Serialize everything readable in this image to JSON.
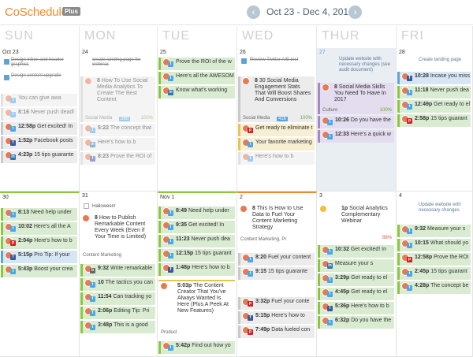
{
  "app": {
    "logo": "CoSchedule",
    "badge": "Plus",
    "range": "Oct 23 - Dec 4, 2016",
    "prev_icon": "chevron-left-icon",
    "next_icon": "chevron-right-icon"
  },
  "days": [
    "SUN",
    "MON",
    "TUE",
    "WED",
    "THUR",
    "FRI"
  ],
  "week1": {
    "sun": {
      "num": "Oct 23",
      "todos": [
        "Design inbox and header graphics",
        "Design content upgrade"
      ],
      "cards": [
        {
          "t": "",
          "txt": "You can give awa"
        },
        {
          "t": "8:16",
          "txt": "Never push deadl"
        },
        {
          "t": "12:58p",
          "txt": "Get excited! In"
        },
        {
          "t": "1:52p",
          "txt": "Facebook posts"
        },
        {
          "t": "4:23p",
          "txt": "15 tips guarante"
        }
      ]
    },
    "mon": {
      "num": "24",
      "todo": "create landing page for webinar",
      "big": {
        "num": "8",
        "title": "How To Use Social Media Analytics To Create The Best Content",
        "cat": "Social Media",
        "views": "260",
        "pct": "100%"
      },
      "cards": [
        {
          "t": "5:22",
          "txt": "The concept that"
        },
        {
          "t": "",
          "txt": "Here's how to b"
        },
        {
          "t": "8:23",
          "txt": "Prove the ROI of"
        }
      ]
    },
    "tue": {
      "num": "25",
      "cards": [
        {
          "t": "",
          "txt": "Prove the ROI of the w"
        },
        {
          "t": "",
          "txt": "Here's all the AWESOM"
        },
        {
          "t": "",
          "txt": "Know what's working"
        }
      ]
    },
    "wed": {
      "num": "26",
      "todo": "Review Twitter A/B test",
      "big": {
        "num": "8",
        "title": "30 Social Media Engagement Stats That Will Boost Shares And Conversions",
        "cat": "Social Media",
        "views": "416",
        "pct": "100%"
      },
      "cards": [
        {
          "t": "",
          "txt": "Get ready to eliminate t"
        },
        {
          "t": "",
          "txt": "Your favorite marketing"
        },
        {
          "t": "",
          "txt": "Here's how to b"
        }
      ]
    },
    "thu": {
      "num": "27",
      "todo": "Update website with necessary changes (see audit document)",
      "big": {
        "num": "8",
        "title": "Social Media Skills You Need To Have In 2017",
        "cat": "Culture",
        "pct": "100%"
      },
      "cards": [
        {
          "t": "10:26",
          "txt": "Do you have the"
        },
        {
          "t": "12:33",
          "txt": "Here's a quick w"
        }
      ]
    },
    "fri": {
      "num": "28",
      "todo": "Create landing page",
      "cards": [
        {
          "t": "10:28",
          "txt": "Incase you miss"
        },
        {
          "t": "11:18",
          "txt": "Never push dea"
        },
        {
          "t": "12:49p",
          "txt": "Get ready to el"
        },
        {
          "t": "2:58p",
          "txt": "15 tips guarant"
        }
      ]
    }
  },
  "week2": {
    "sun": {
      "num": "30",
      "cards": [
        {
          "t": "8:13",
          "txt": "Need help under"
        },
        {
          "t": "10:02",
          "txt": "Here's all the A"
        },
        {
          "t": "2:04p",
          "txt": "Here's how to b"
        },
        {
          "t": "5:15p",
          "txt": "Pro Tip: If your"
        },
        {
          "t": "5:43p",
          "txt": "Boost your crea"
        }
      ]
    },
    "mon": {
      "num": "31",
      "todo": "Halloween!",
      "big": {
        "num": "8",
        "title": "How to Publish Remarkable Content Every Week (Even if Your Time is Limited)",
        "cat": "Content Marketing",
        "pct": "100%"
      },
      "cards": [
        {
          "t": "9:32",
          "txt": "Write remarkable"
        },
        {
          "t": "10",
          "txt": "The tactics you can"
        },
        {
          "t": "11:54",
          "txt": "Can tracking yo"
        },
        {
          "t": "2:06p",
          "txt": "Editing Tip: Pri"
        },
        {
          "t": "3:48p",
          "txt": "This is a good"
        }
      ]
    },
    "tue": {
      "num": "Nov 1",
      "cards": [
        {
          "t": "8:49",
          "txt": "Need help under"
        },
        {
          "t": "9:35",
          "txt": "Get excited! In"
        },
        {
          "t": "11:23",
          "txt": "Never push dea"
        },
        {
          "t": "12:15p",
          "txt": "15 tips guarant"
        },
        {
          "t": "1:48p",
          "txt": "Here's how to b"
        },
        {
          "t": "5:42p",
          "txt": "Find out how yo"
        }
      ],
      "big": {
        "t": "5:03p",
        "title": "The Content Creator That You've Always Wanted Is Here (Plus A Peek At New Features)",
        "cat": "Product",
        "pct": "100%"
      }
    },
    "wed": {
      "num": "2",
      "big": {
        "num": "8",
        "title": "This Is How to Use Data to Fuel Your Content Marketing Strategy",
        "cat": "Content Marketing, Pr",
        "pct": "100%"
      },
      "cards": [
        {
          "t": "8:20",
          "txt": "Fuel your content"
        },
        {
          "t": "9:15",
          "txt": "15 tips guarante"
        },
        {
          "t": "3:32p",
          "txt": "Fuel your conte"
        },
        {
          "t": "5:15p",
          "txt": "Here's how to"
        },
        {
          "t": "7:49p",
          "txt": "Data fueled con"
        }
      ]
    },
    "thu": {
      "num": "3",
      "big": {
        "num": "1p",
        "title": "Social Analytics Complementary Webinar",
        "pct": "88%"
      },
      "cards": [
        {
          "t": "10:32",
          "txt": "Get excited! In"
        },
        {
          "t": "",
          "txt": "Measure your s"
        },
        {
          "t": "3:29p",
          "txt": "Get ready to el"
        },
        {
          "t": "4:45p",
          "txt": "Get ready to el"
        },
        {
          "t": "5:36p",
          "txt": "Here's how to b"
        },
        {
          "t": "6:32p",
          "txt": "Do you have the"
        }
      ]
    },
    "fri": {
      "num": "4",
      "todo": "Update website with necessary changes",
      "cards": [
        {
          "t": "9:32",
          "txt": "Measure your s"
        },
        {
          "t": "10:15",
          "txt": "What should yo"
        },
        {
          "t": "12:58p",
          "txt": "Prove the ROI"
        },
        {
          "t": "2:45p",
          "txt": "15 tips guarant"
        },
        {
          "t": "4:28p",
          "txt": "The concept be"
        }
      ]
    }
  }
}
